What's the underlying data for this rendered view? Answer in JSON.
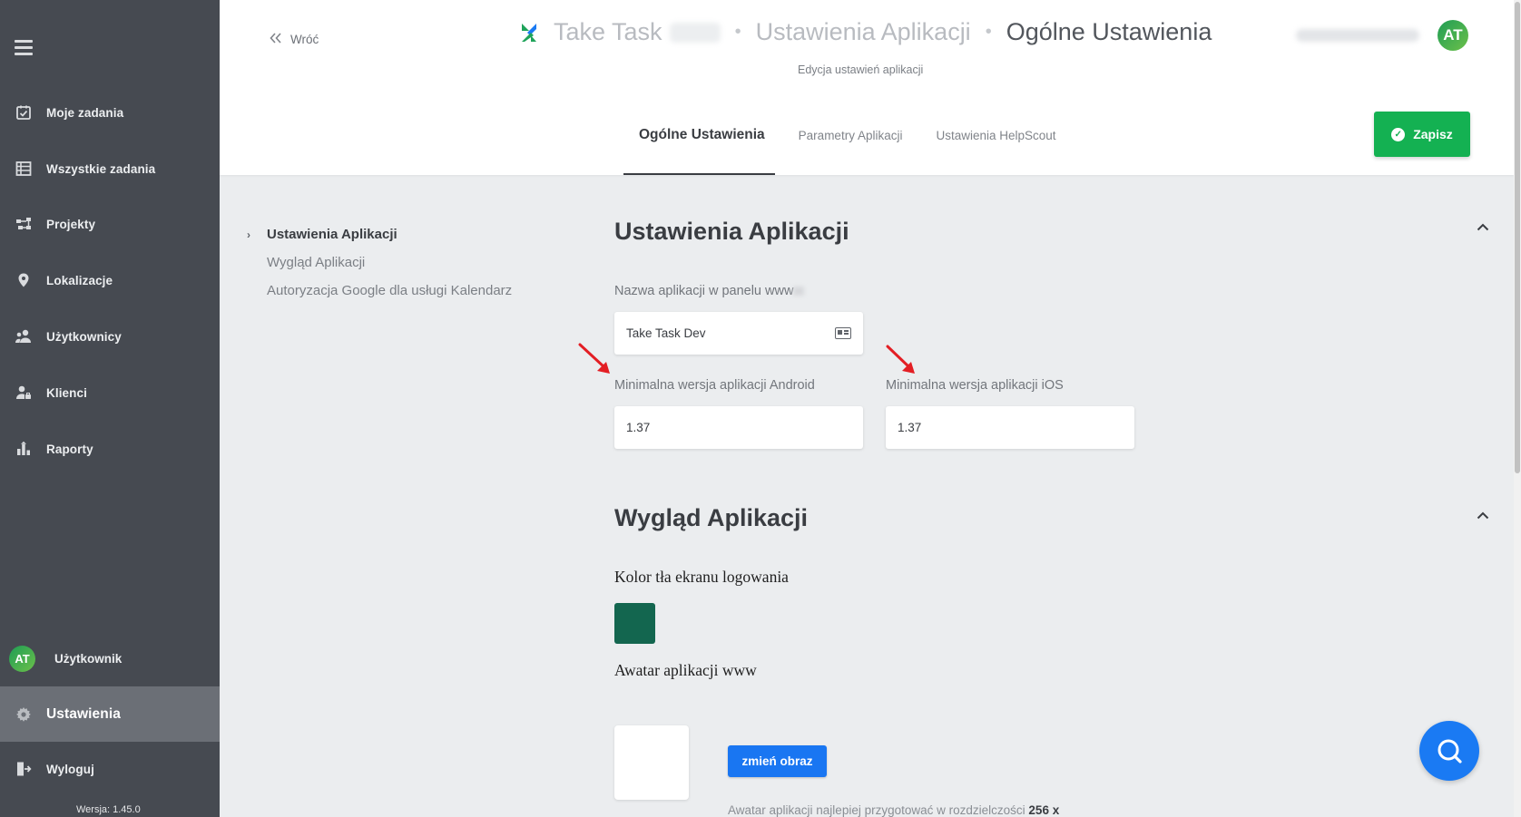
{
  "sidebar": {
    "menu_icon": "hamburger-icon",
    "items": [
      {
        "label": "Moje zadania",
        "icon": "task-check-icon"
      },
      {
        "label": "Wszystkie zadania",
        "icon": "list-icon"
      },
      {
        "label": "Projekty",
        "icon": "projects-icon"
      },
      {
        "label": "Lokalizacje",
        "icon": "map-pin-icon"
      },
      {
        "label": "Użytkownicy",
        "icon": "users-icon"
      },
      {
        "label": "Klienci",
        "icon": "client-icon"
      },
      {
        "label": "Raporty",
        "icon": "reports-icon"
      }
    ],
    "user": {
      "initials": "AT",
      "label": "Użytkownik"
    },
    "settings": {
      "label": "Ustawienia",
      "icon": "gear-icon"
    },
    "logout": {
      "label": "Wyloguj",
      "icon": "logout-icon"
    },
    "version": "Wersja: 1.45.0"
  },
  "header": {
    "back_label": "Wróć",
    "breadcrumb": [
      "Take Task",
      "Ustawienia Aplikacji",
      "Ogólne Ustawienia"
    ],
    "subtitle": "Edycja ustawień aplikacji",
    "avatar_initials": "AT",
    "tabs": [
      "Ogólne Ustawienia",
      "Parametry Aplikacji",
      "Ustawienia HelpScout"
    ],
    "active_tab": 0,
    "save_label": "Zapisz"
  },
  "subnav": {
    "items": [
      "Ustawienia Aplikacji",
      "Wygląd Aplikacji",
      "Autoryzacja Google dla usługi Kalendarz"
    ]
  },
  "app_settings": {
    "title": "Ustawienia Aplikacji",
    "app_name_label": "Nazwa aplikacji w panelu www",
    "app_name_value": "Take Task Dev",
    "android_label": "Minimalna wersja aplikacji Android",
    "android_value": "1.37",
    "ios_label": "Minimalna wersja aplikacji iOS",
    "ios_value": "1.37"
  },
  "appearance": {
    "title": "Wygląd Aplikacji",
    "login_color_label": "Kolor tła ekranu logowania",
    "login_color": "#13664f",
    "avatar_label": "Awatar aplikacji www",
    "change_image_label": "zmień obraz",
    "hint_text": "Awatar aplikacji najlepiej przygotować w rozdzielczości",
    "hint_bold": "256 x"
  },
  "colors": {
    "sidebar_bg": "#464a51",
    "save_green": "#14b152",
    "primary_blue": "#1a7af3"
  }
}
